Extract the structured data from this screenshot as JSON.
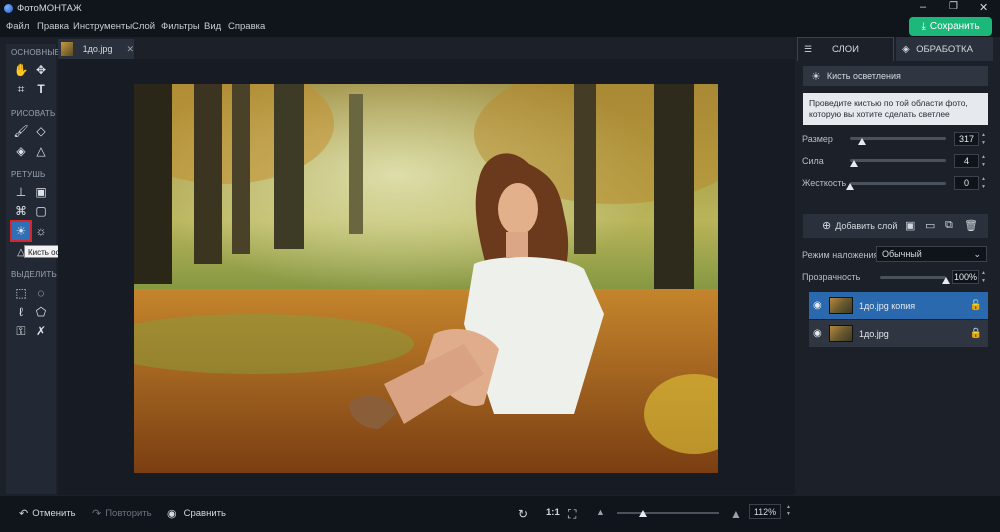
{
  "app": {
    "title": "ФотоМОНТАЖ"
  },
  "menu": [
    "Файл",
    "Правка",
    "Инструменты",
    "Слой",
    "Фильтры",
    "Вид",
    "Справка"
  ],
  "save_label": "Сохранить",
  "tools": {
    "sections": [
      "ОСНОВНЫЕ",
      "РИСОВАТЬ",
      "РЕТУШЬ",
      "ВЫДЕЛИТЬ"
    ],
    "tooltip": "Кисть осветления"
  },
  "document": {
    "tab_name": "1до.jpg"
  },
  "bottom": {
    "undo": "Отменить",
    "redo": "Повторить",
    "compare": "Сравнить",
    "ratio": "1:1",
    "zoom": "112%",
    "zoom_level": 0.25
  },
  "panel": {
    "tabs": [
      "СЛОИ",
      "ОБРАБОТКА"
    ],
    "tool_name": "Кисть осветления",
    "hint": "Проведите кистью по той области фото, которую вы хотите сделать светлее",
    "size_label": "Размер",
    "size_value": "317",
    "size_level": 0.12,
    "strength_label": "Сила",
    "strength_value": "4",
    "strength_level": 0.04,
    "hardness_label": "Жесткость",
    "hardness_value": "0",
    "hardness_level": 0.0,
    "add_layer": "Добавить слой",
    "blend_label": "Режим наложения:",
    "blend_value": "Обычный",
    "opacity_label": "Прозрачность",
    "opacity_value": "100%",
    "layers": [
      {
        "name": "1до.jpg копия",
        "selected": true
      },
      {
        "name": "1до.jpg",
        "selected": false
      }
    ]
  },
  "colors": {
    "accent": "#1bb87a",
    "selected_layer": "#2a69ad",
    "tool_highlight": "#d6262b"
  }
}
